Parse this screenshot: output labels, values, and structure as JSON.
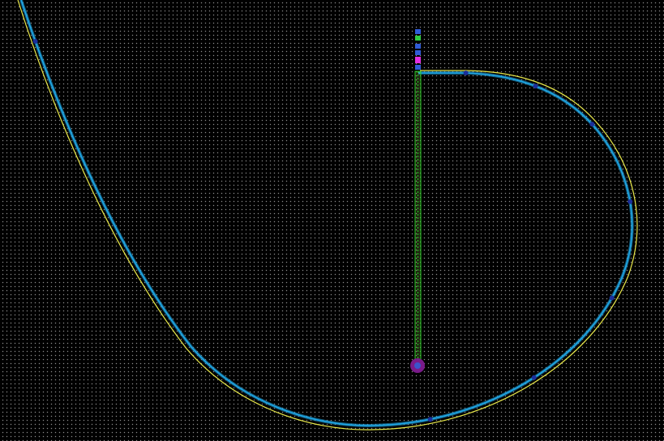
{
  "viewport": {
    "grid_visible": true,
    "background_color": "#000000",
    "grid_color": "#8a8a8a"
  },
  "colors": {
    "curve_primary": "#1fa7e6",
    "curve_secondary": "#e8e84a",
    "axis_outline": "#22cc22",
    "axis_fill": "#ccff66",
    "control_point": "#1b2f9a",
    "pivot_outer": "#7a1a8a",
    "pivot_inner": "#3a55cc",
    "marker_green": "#2ecc40",
    "marker_blue": "#2f5bd6",
    "marker_magenta": "#e22ee2"
  },
  "icons": {
    "pivot": "pivot-handle-icon",
    "control_point": "control-point-icon",
    "axis_markers": "axis-marker-icon"
  }
}
